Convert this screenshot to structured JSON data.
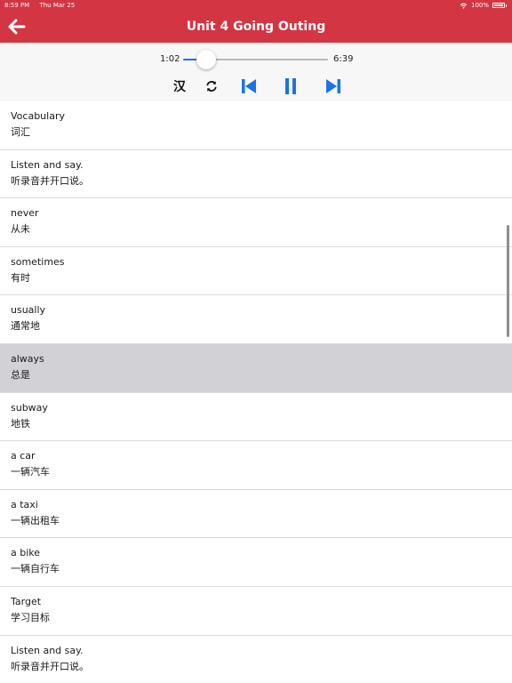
{
  "status_bar": {
    "time": "8:59 PM",
    "date": "Thu Mar 25",
    "battery": "100%"
  },
  "header": {
    "title": "Unit 4 Going Outing",
    "back_icon": "arrow-left-icon",
    "color": "#d33543"
  },
  "player": {
    "current_time": "1:02",
    "total_time": "6:39",
    "progress": 0.16,
    "han_label": "汉",
    "accent_color": "#1a73e8"
  },
  "list": {
    "selected_index": 5,
    "items": [
      {
        "en": "Vocabulary",
        "zh": "词汇"
      },
      {
        "en": "Listen and say.",
        "zh": "听录音并开口说。"
      },
      {
        "en": "never",
        "zh": "从未"
      },
      {
        "en": "sometimes",
        "zh": "有时"
      },
      {
        "en": "usually",
        "zh": "通常地"
      },
      {
        "en": "always",
        "zh": "总是"
      },
      {
        "en": "subway",
        "zh": "地铁"
      },
      {
        "en": "a car",
        "zh": "一辆汽车"
      },
      {
        "en": "a taxi",
        "zh": "一辆出租车"
      },
      {
        "en": "a bike",
        "zh": "一辆自行车"
      },
      {
        "en": "Target",
        "zh": "学习目标"
      },
      {
        "en": "Listen and say.",
        "zh": "听录音并开口说。"
      }
    ]
  }
}
